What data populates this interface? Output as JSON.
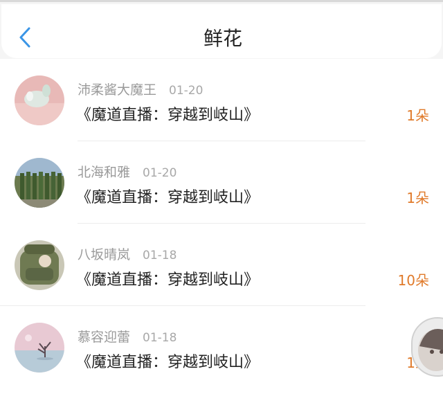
{
  "header": {
    "title": "鲜花",
    "back_icon": "chevron-left-icon",
    "accent_color": "#3a95e6"
  },
  "items": [
    {
      "user": "沛柔酱大魔王",
      "date": "01-20",
      "work": "《魔道直播：穿越到岐山》",
      "count": "1朵"
    },
    {
      "user": "北海和雅",
      "date": "01-20",
      "work": "《魔道直播：穿越到岐山》",
      "count": "1朵"
    },
    {
      "user": "八坂晴岚",
      "date": "01-18",
      "work": "《魔道直播：穿越到岐山》",
      "count": "10朵"
    },
    {
      "user": "慕容迎蕾",
      "date": "01-18",
      "work": "《魔道直播：穿越到岐山》",
      "count": "1朵"
    }
  ],
  "colors": {
    "count": "#e07a2a",
    "username": "#9a9a9a",
    "work_title": "#222222"
  }
}
